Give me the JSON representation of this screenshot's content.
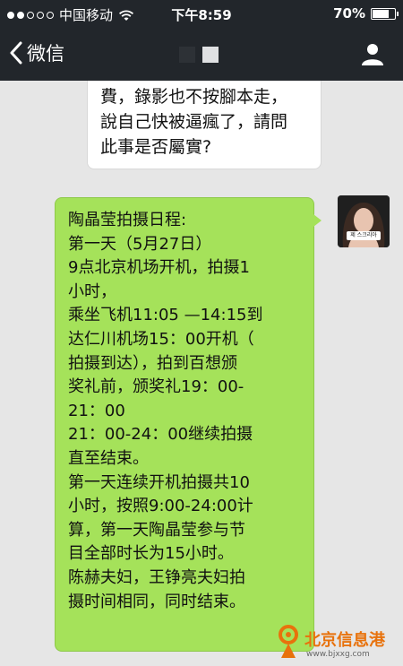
{
  "status_bar": {
    "carrier": "中国移动",
    "time": "下午8:59",
    "battery": "70%",
    "battery_level": 0.7,
    "signal_bars": 2
  },
  "nav_bar": {
    "back_label": "微信",
    "back_icon": "chevron-left-icon",
    "profile_icon": "person-icon"
  },
  "messages": {
    "incoming": {
      "lines": [
        "費，錄影也不按腳本走，",
        "說自己快被逼瘋了，請問",
        "此事是否屬實?"
      ]
    },
    "outgoing": {
      "lines": [
        "陶晶莹拍摄日程:",
        "第一天（5月27日）",
        "9点北京机场开机，拍摄1",
        "小时，",
        "乘坐飞机11:05 —14:15到",
        "达仁川机场15：00开机（",
        "拍摄到达），拍到百想颁",
        "奖礼前，颁奖礼19：00-",
        "21：00",
        "21：00-24：00继续拍摄",
        "直至结束。",
        "第一天连续开机拍摄共10",
        "小时，按照9:00-24:00计",
        "算，第一天陶晶莹参与节",
        "目全部时长为15小时。",
        "陈赫夫妇，王铮亮夫妇拍",
        "摄时间相同，同时结束。"
      ]
    }
  },
  "avatar": {
    "caption": "제 스크리아"
  },
  "watermark": {
    "title": "北京信息港",
    "url": "www.bjxxg.com"
  },
  "colors": {
    "bar": "#22262b",
    "chat_bg": "#e6e6e6",
    "outgoing_bubble": "#a5e25a",
    "watermark": "#e8720c"
  }
}
